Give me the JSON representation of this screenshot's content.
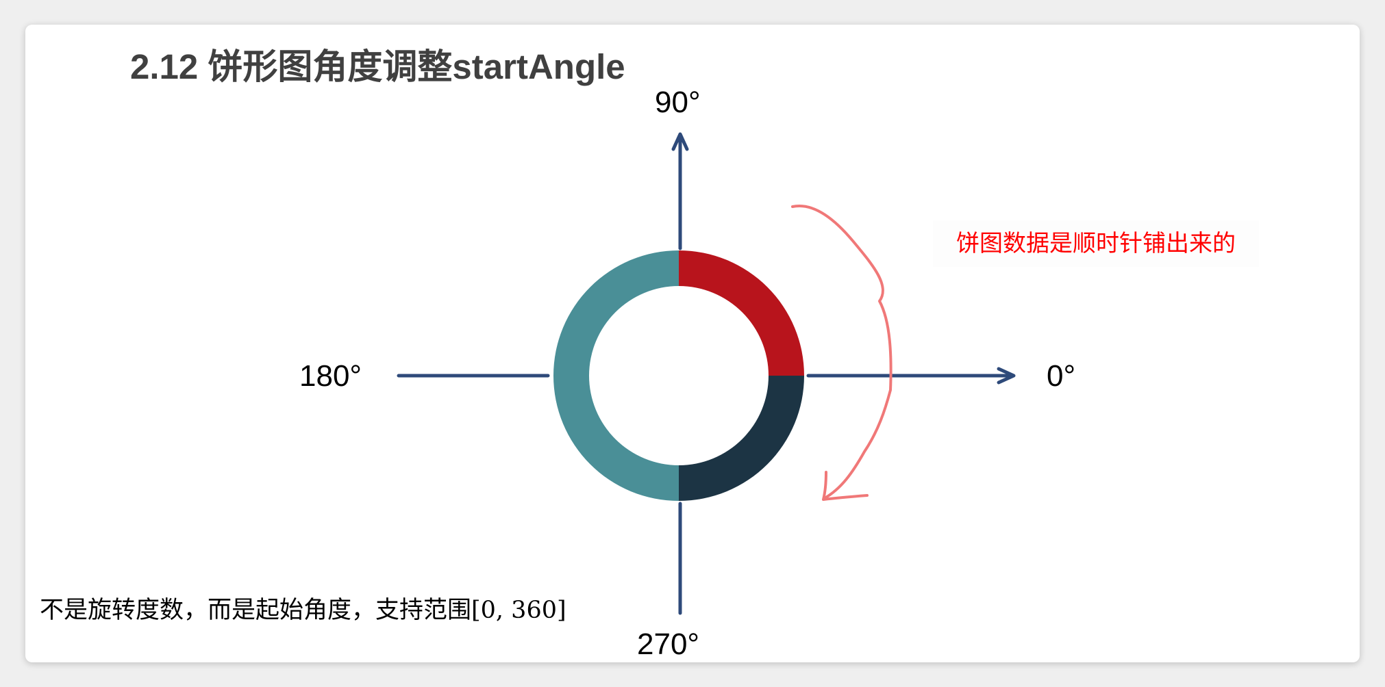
{
  "title": "2.12 饼形图角度调整startAngle",
  "axis_labels": {
    "top": "90°",
    "right": "0°",
    "left": "180°",
    "bottom": "270°"
  },
  "note": "饼图数据是顺时针铺出来的",
  "caption": "不是旋转度数，而是起始角度，支持范围[0, 360]",
  "colors": {
    "axis": "#2e4a7a",
    "segment_red": "#b8141c",
    "segment_navy": "#1c3444",
    "segment_teal": "#4a8f97",
    "arrow_annotation": "#f07878",
    "note_text": "#ff0000"
  },
  "chart_data": {
    "type": "pie",
    "variant": "donut",
    "start_angle": 90,
    "direction": "clockwise",
    "slices": [
      {
        "start": 90,
        "end": 0,
        "color": "#b8141c"
      },
      {
        "start": 0,
        "end": -90,
        "color": "#1c3444"
      },
      {
        "start": -90,
        "end": -270,
        "color": "#4a8f97"
      }
    ]
  }
}
